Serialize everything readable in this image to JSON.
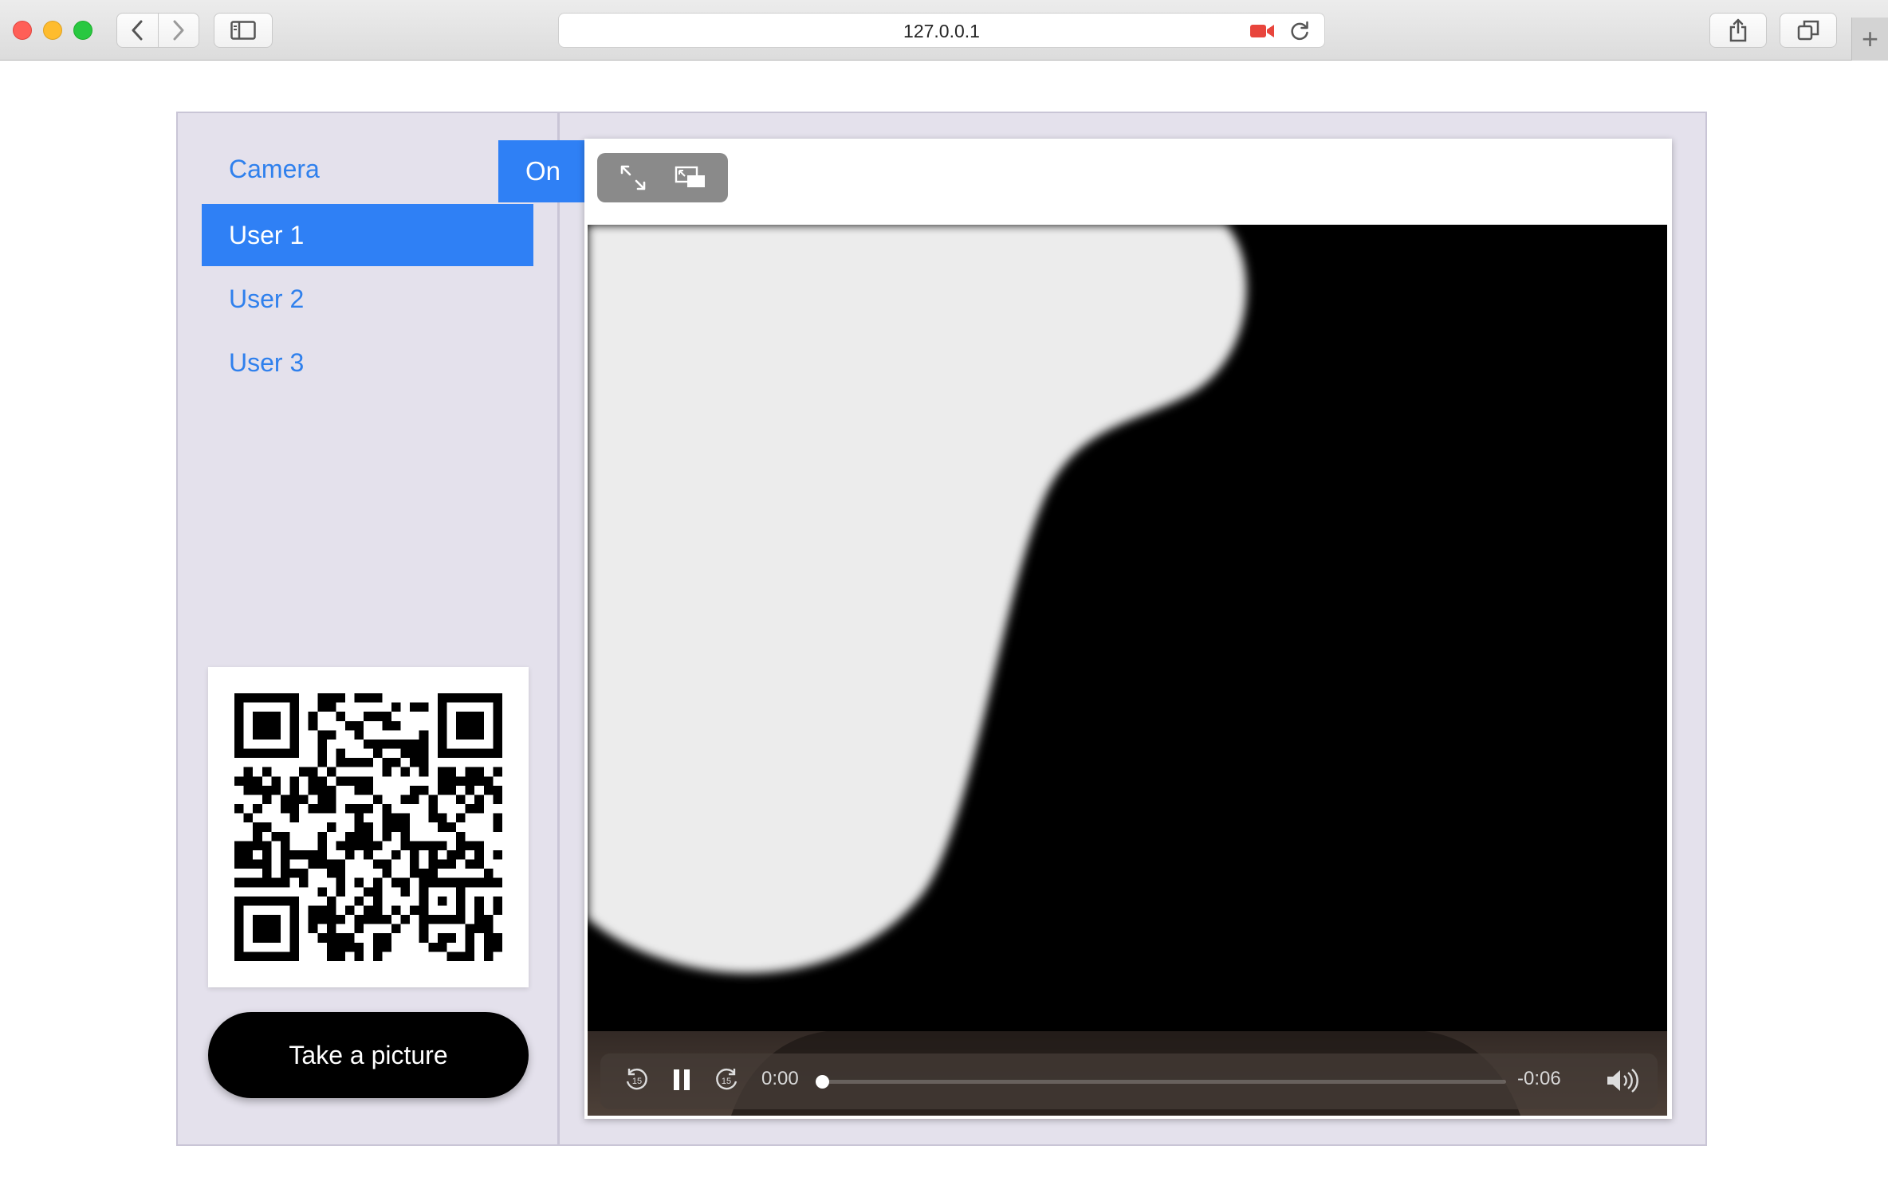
{
  "browser": {
    "url": "127.0.0.1"
  },
  "sidebar": {
    "camera_label": "Camera",
    "camera_toggle": "On",
    "users": [
      "User 1",
      "User 2",
      "User 3"
    ],
    "active_user": "User 1",
    "take_picture_label": "Take a picture"
  },
  "player": {
    "elapsed": "0:00",
    "remaining": "-0:06",
    "progress": 0.0
  },
  "colors": {
    "accent": "#2f80f5",
    "panel_bg": "#e4e1ec",
    "button_dark": "#000000"
  },
  "icons": [
    "back-icon",
    "forward-icon",
    "sidebar-icon",
    "camera-recording-icon",
    "reload-icon",
    "share-icon",
    "tabs-overview-icon",
    "new-tab-icon",
    "qr-code",
    "fullscreen-icon",
    "picture-in-picture-icon",
    "skip-back-15-icon",
    "pause-icon",
    "skip-forward-15-icon",
    "volume-icon"
  ]
}
